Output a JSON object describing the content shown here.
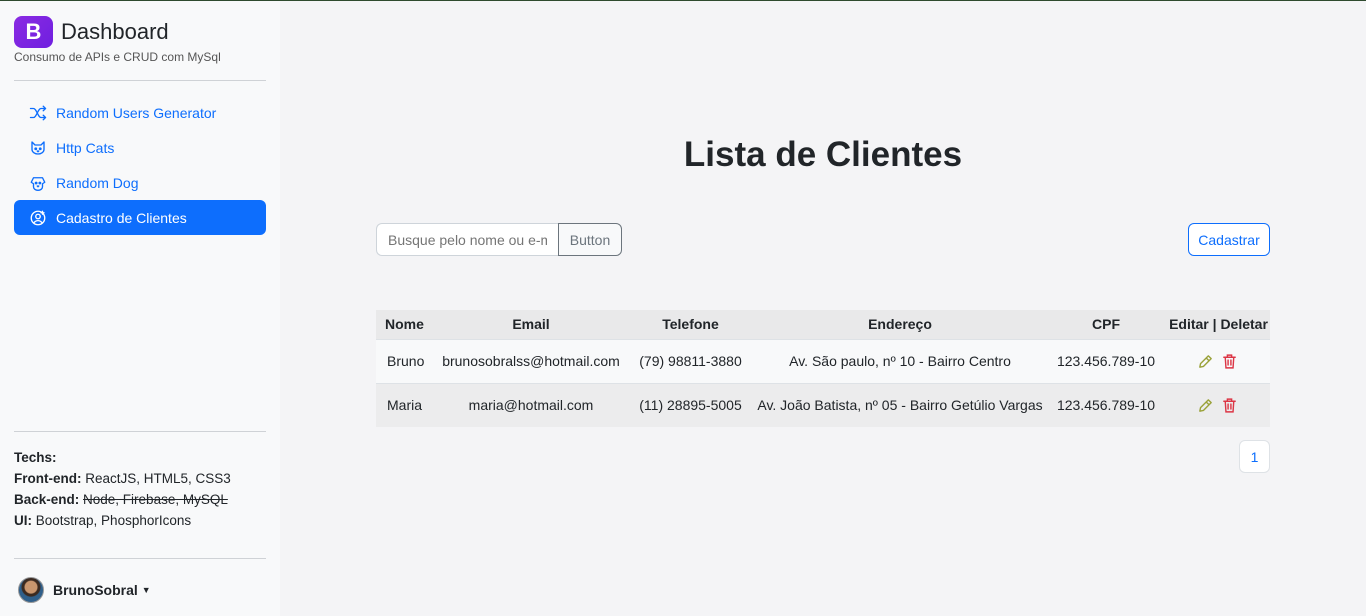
{
  "brand": {
    "logo_letter": "B",
    "title": "Dashboard",
    "subtitle": "Consumo de APIs e CRUD com MySql"
  },
  "sidebar": {
    "items": [
      {
        "label": "Random Users Generator",
        "icon": "shuffle-icon",
        "active": false
      },
      {
        "label": "Http Cats",
        "icon": "cat-icon",
        "active": false
      },
      {
        "label": "Random Dog",
        "icon": "dog-icon",
        "active": false
      },
      {
        "label": "Cadastro de Clientes",
        "icon": "user-circle-plus-icon",
        "active": true
      }
    ]
  },
  "techs": {
    "heading": "Techs:",
    "frontend_label": "Front-end:",
    "frontend_value": "ReactJS, HTML5, CSS3",
    "backend_label": "Back-end:",
    "backend_value": "Node, Firebase, MySQL",
    "ui_label": "UI:",
    "ui_value": "Bootstrap, PhosphorIcons"
  },
  "user": {
    "name": "BrunoSobral"
  },
  "main": {
    "title": "Lista de Clientes",
    "search": {
      "placeholder": "Busque pelo nome ou e-mail",
      "button_label": "Button"
    },
    "add_button_label": "Cadastrar",
    "table": {
      "headers": [
        "Nome",
        "Email",
        "Telefone",
        "Endereço",
        "CPF",
        "Editar | Deletar"
      ],
      "rows": [
        [
          "Bruno",
          "brunosobralss@hotmail.com",
          "(79) 98811-3880",
          "Av. São paulo, nº 10 - Bairro Centro",
          "123.456.789-10"
        ],
        [
          "Maria",
          "maria@hotmail.com",
          "(11) 28895-5005",
          "Av. João Batista, nº 05 - Bairro Getúlio Vargas",
          "123.456.789-10"
        ]
      ]
    },
    "pagination": {
      "current": "1"
    }
  },
  "colors": {
    "primary": "#0d6efd",
    "brand": "#7b22e6",
    "edit": "#9aa23a",
    "delete": "#dc3545"
  }
}
